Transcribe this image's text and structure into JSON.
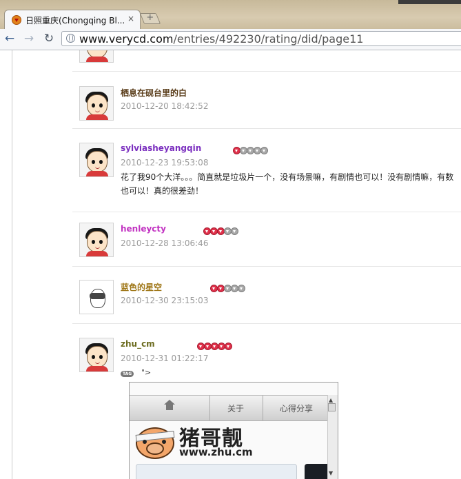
{
  "browser": {
    "tab_title": "日照重庆(Chongqing Bl...",
    "tab_close": "×",
    "new_tab": "+",
    "url_domain": "www.verycd.com",
    "url_path": "/entries/492230/rating/did/page11",
    "back": "←",
    "forward": "→",
    "reload": "↻"
  },
  "entries": [
    {
      "name": "栖息在砚台里的白",
      "date": "2010-12-20 18:42:52",
      "name_color": "#5a3d1a"
    },
    {
      "name": "sylviasheyangqin",
      "date": "2010-12-23 19:53:08",
      "name_color": "#7b2fbf",
      "rating": 1,
      "comment_line1": "花了我90个大洋。。。简直就是垃圾片一个，没有场景嘛，有剧情也可以！没有剧情嘛，有数",
      "comment_line2": "也可以！真的很差劲！"
    },
    {
      "name": "henleycty",
      "date": "2010-12-28 13:06:46",
      "name_color": "#c233c2",
      "rating": 3
    },
    {
      "name": "蓝色的星空",
      "date": "2010-12-30 23:15:03",
      "name_color": "#a0781a",
      "rating": 2
    },
    {
      "name": "zhu_cm",
      "date": "2010-12-31 01:22:17",
      "name_color": "#6b6b1e",
      "rating": 5,
      "tag_badge": "TAG",
      "tag_text": "\">"
    }
  ],
  "embed": {
    "nav_about": "关于",
    "nav_share": "心得分享",
    "logo_title": "猪哥靓",
    "logo_url": "www.zhu.cm",
    "scroll_up": "▲",
    "scroll_down": "▼"
  },
  "colors": {
    "star_on": "#e0314b",
    "star_off": "#a8a8a8"
  }
}
